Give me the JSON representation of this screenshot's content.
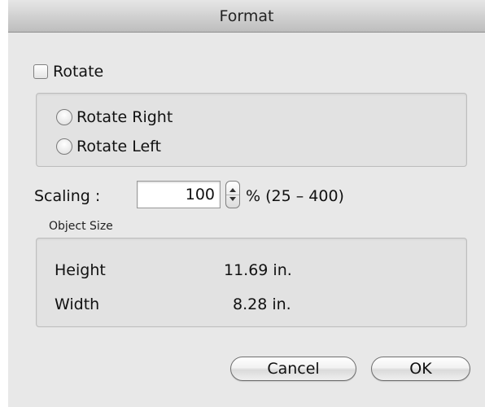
{
  "window": {
    "title": "Format"
  },
  "rotate": {
    "checkbox_label": "Rotate",
    "checked": false,
    "options": [
      {
        "label": "Rotate Right",
        "selected": false
      },
      {
        "label": "Rotate Left",
        "selected": false
      }
    ]
  },
  "scaling": {
    "label": "Scaling :",
    "value": "100",
    "range_text": "% (25 – 400)"
  },
  "object_size": {
    "caption": "Object Size",
    "rows": [
      {
        "label": "Height",
        "value": "11.69 in."
      },
      {
        "label": "Width",
        "value": "8.28 in."
      }
    ]
  },
  "buttons": {
    "cancel_label": "Cancel",
    "ok_label": "OK"
  }
}
